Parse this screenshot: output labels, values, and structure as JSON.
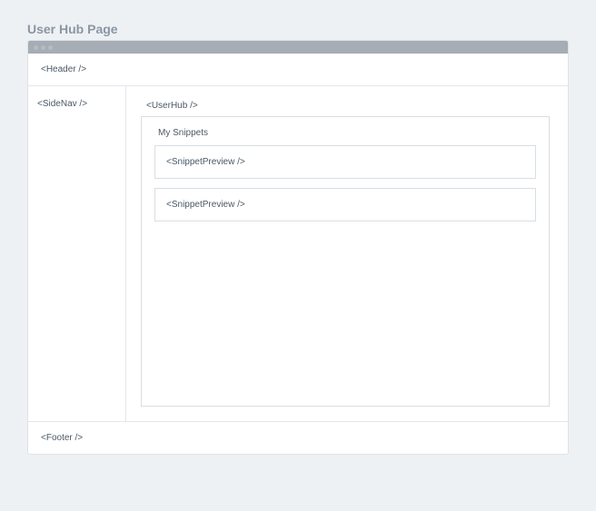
{
  "wireframe": {
    "title": "User Hub Page",
    "header_label": "<Header />",
    "sidenav_label": "<SideNav />",
    "userhub_label": "<UserHub />",
    "section_title": "My Snippets",
    "snippets": [
      {
        "label": "<SnippetPreview />"
      },
      {
        "label": "<SnippetPreview />"
      }
    ],
    "footer_label": "<Footer />"
  }
}
